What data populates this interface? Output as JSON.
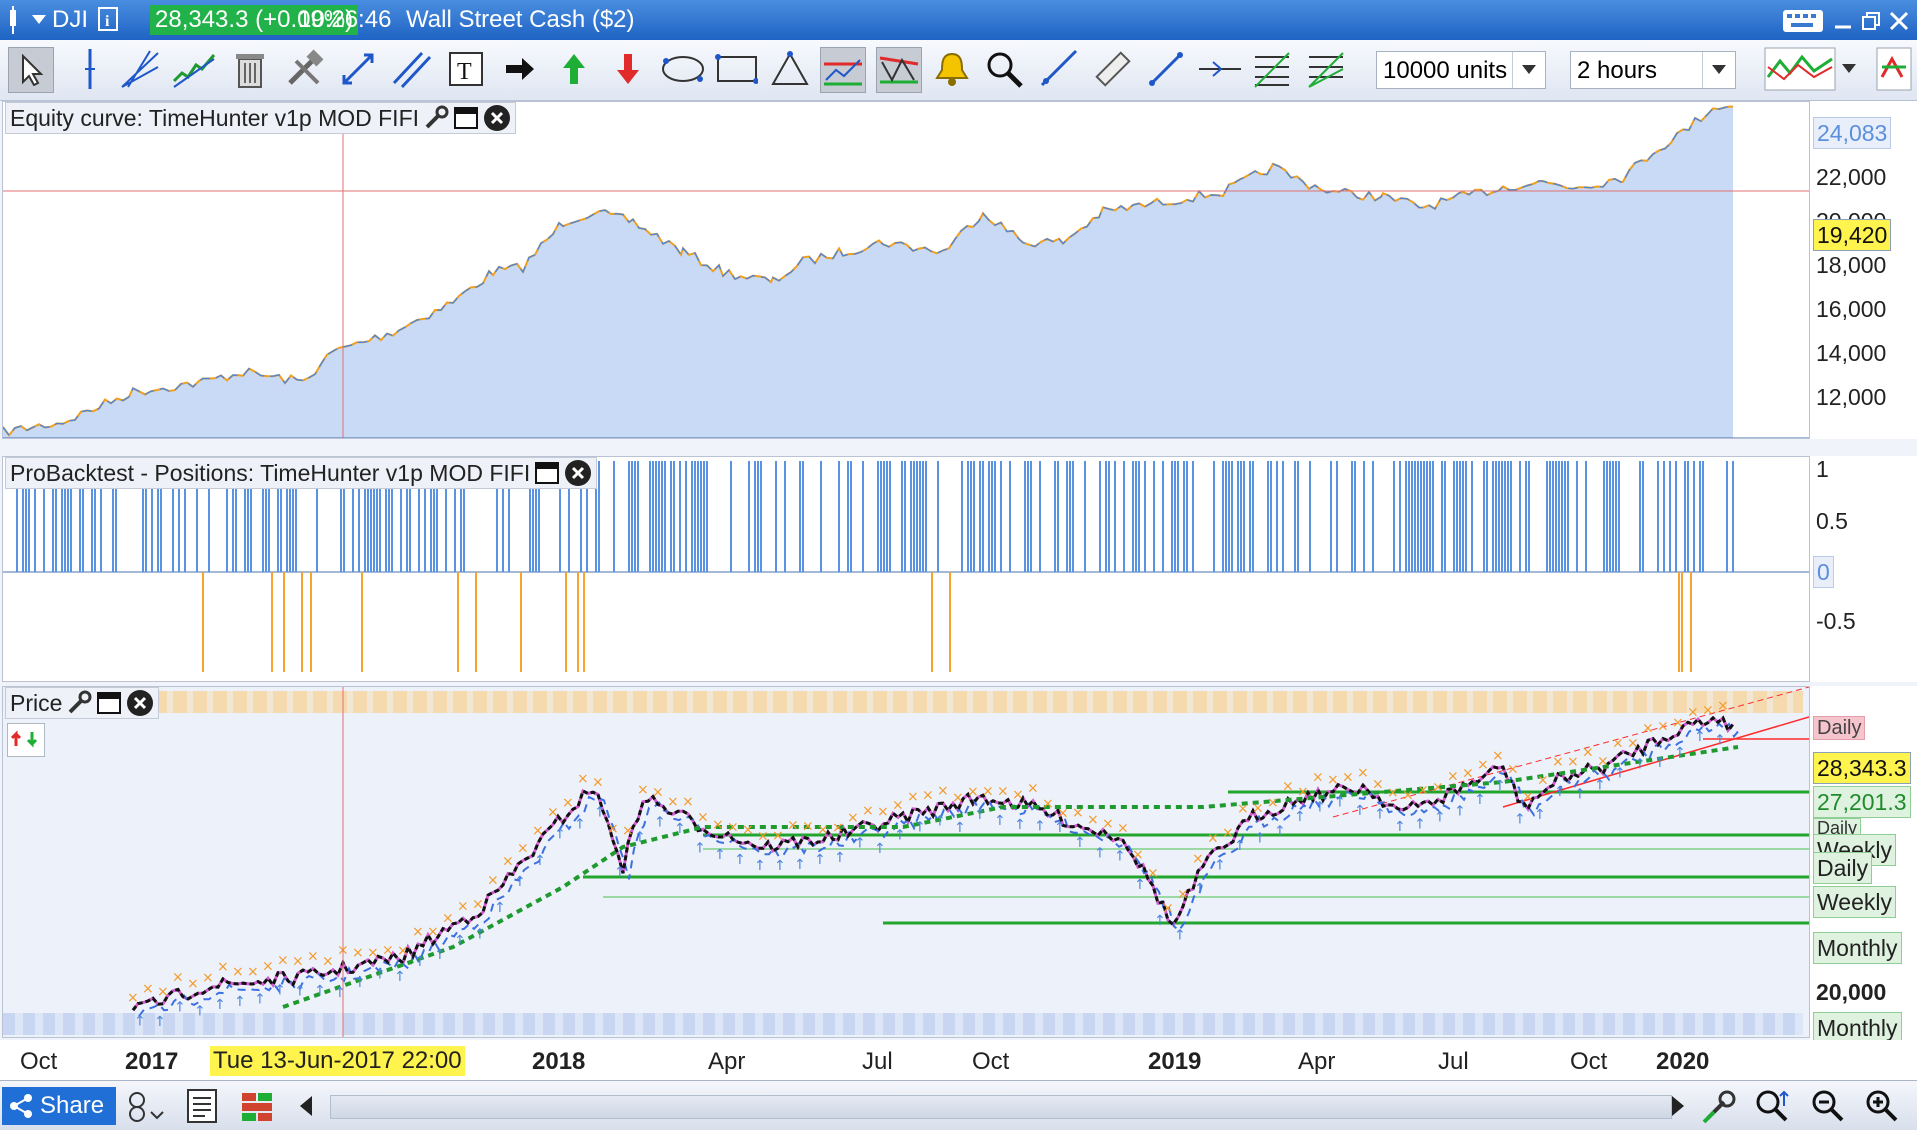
{
  "titlebar": {
    "symbol": "DJI",
    "price_badge": "28,343.3 (+0.09%)",
    "time": "10:26:46",
    "instrument": "Wall Street Cash ($2)"
  },
  "toolbar": {
    "units_value": "10000 units",
    "timeframe_value": "2 hours"
  },
  "equity_panel": {
    "title": "Equity curve: TimeHunter v1p MOD FIFI",
    "ticks": [
      "24,083",
      "22,000",
      "20,000",
      "18,000",
      "16,000",
      "14,000",
      "12,000"
    ],
    "crosshair_value": "19,420",
    "colors": {
      "fill": "#c8daf6",
      "line_up": "#4f86d8",
      "line_down": "#f0a020"
    }
  },
  "positions_panel": {
    "title": "ProBacktest - Positions: TimeHunter v1p MOD FIFI",
    "ticks": [
      "1",
      "0.5",
      "0",
      "-0.5"
    ],
    "colors": {
      "long": "#5b93e3",
      "short": "#f6a42f"
    }
  },
  "price_panel": {
    "title": "Price",
    "ticks": [
      "20,000"
    ],
    "labels": [
      {
        "text": "Daily",
        "kind": "pink"
      },
      {
        "text": "28,343.3",
        "kind": "yellow"
      },
      {
        "text": "27,201.3",
        "kind": "green"
      },
      {
        "text": "Daily",
        "kind": "green"
      },
      {
        "text": "Weekly",
        "kind": "green"
      },
      {
        "text": "Daily",
        "kind": "green"
      },
      {
        "text": "Weekly",
        "kind": "green"
      },
      {
        "text": "Monthly",
        "kind": "green"
      },
      {
        "text": "Monthly",
        "kind": "green"
      }
    ],
    "colors": {
      "candle": "#111111",
      "support": "#22a52d",
      "trend": "#ff2b2b"
    }
  },
  "xaxis": {
    "labels": [
      "Oct",
      "2017",
      "2018",
      "Apr",
      "Jul",
      "Oct",
      "2019",
      "Apr",
      "Jul",
      "Oct",
      "2020"
    ],
    "crosshair_date": "Tue 13-Jun-2017 22:00"
  },
  "bottom": {
    "share_label": "Share"
  }
}
